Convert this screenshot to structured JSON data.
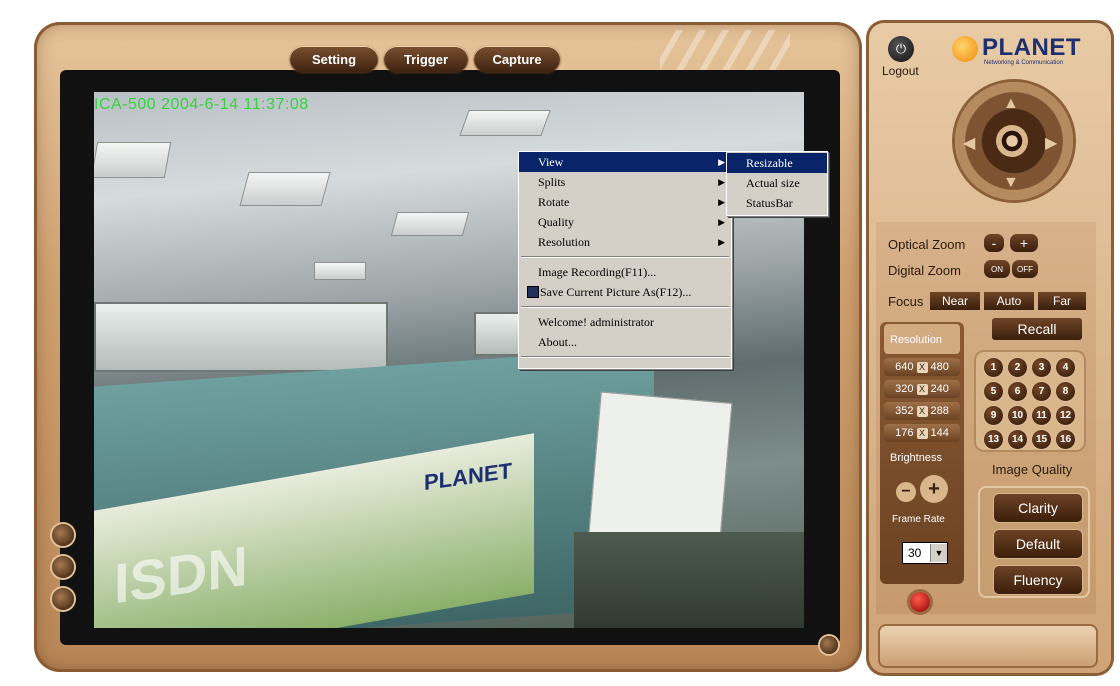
{
  "top_buttons": {
    "setting": "Setting",
    "trigger": "Trigger",
    "capture": "Capture"
  },
  "video": {
    "timestamp": "ICA-500  2004-6-14 11:37:08",
    "overlay_brand": "PLANET",
    "overlay_text": "ISDN"
  },
  "context_menu": {
    "items": [
      "View",
      "Splits",
      "Rotate",
      "Quality",
      "Resolution"
    ],
    "recording": "Image Recording(F11)...",
    "save_picture": "Save Current Picture As(F12)...",
    "welcome": "Welcome! administrator",
    "about": "About..."
  },
  "view_submenu": {
    "items": [
      "Resizable",
      "Actual size",
      "StatusBar"
    ]
  },
  "panel": {
    "logout": "Logout",
    "brand": "PLANET",
    "brand_sub": "Networking & Communication",
    "optical_zoom": "Optical Zoom",
    "zoom_minus": "-",
    "zoom_plus": "+",
    "digital_zoom": "Digital  Zoom",
    "digital_on": "ON",
    "digital_off": "OFF",
    "focus": "Focus",
    "focus_near": "Near",
    "focus_auto": "Auto",
    "focus_far": "Far",
    "resolution": "Resolution",
    "recall": "Recall",
    "resolutions": [
      {
        "w": "640",
        "h": "480"
      },
      {
        "w": "320",
        "h": "240"
      },
      {
        "w": "352",
        "h": "288"
      },
      {
        "w": "176",
        "h": "144"
      }
    ],
    "res_x": "X",
    "presets": [
      "1",
      "2",
      "3",
      "4",
      "5",
      "6",
      "7",
      "8",
      "9",
      "10",
      "11",
      "12",
      "13",
      "14",
      "15",
      "16"
    ],
    "brightness": "Brightness",
    "image_quality": "Image Quality",
    "frame_rate": "Frame Rate",
    "frame_rate_value": "30",
    "quality_clarity": "Clarity",
    "quality_default": "Default",
    "quality_fluency": "Fluency"
  },
  "colors": {
    "timestamp": "#33d43a",
    "menu_highlight": "#0a246a",
    "panel": "#d7b18a"
  }
}
